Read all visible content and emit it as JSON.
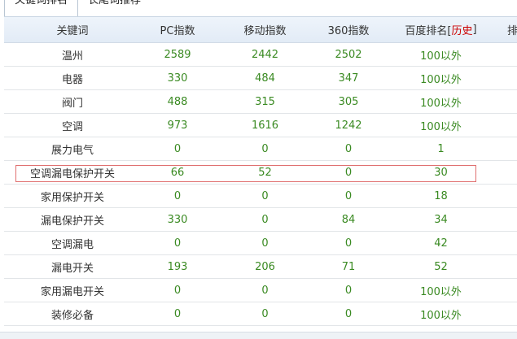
{
  "tabs": [
    {
      "label": "关键词排名"
    },
    {
      "label": "长尾词推荐"
    }
  ],
  "table": {
    "headers": {
      "keyword": "关键词",
      "pc": "PC指数",
      "mobile": "移动指数",
      "so360": "360指数",
      "baidu_prefix": "百度排名[",
      "baidu_history": "历史",
      "baidu_suffix": "]",
      "extra": "排"
    },
    "rows": [
      {
        "keyword": "温州",
        "pc": "2589",
        "mobile": "2442",
        "so360": "2502",
        "baidu": "100以外"
      },
      {
        "keyword": "电器",
        "pc": "330",
        "mobile": "484",
        "so360": "347",
        "baidu": "100以外"
      },
      {
        "keyword": "阀门",
        "pc": "488",
        "mobile": "315",
        "so360": "305",
        "baidu": "100以外"
      },
      {
        "keyword": "空调",
        "pc": "973",
        "mobile": "1616",
        "so360": "1242",
        "baidu": "100以外"
      },
      {
        "keyword": "展力电气",
        "pc": "0",
        "mobile": "0",
        "so360": "0",
        "baidu": "1"
      },
      {
        "keyword": "空调漏电保护开关",
        "pc": "66",
        "mobile": "52",
        "so360": "0",
        "baidu": "30"
      },
      {
        "keyword": "家用保护开关",
        "pc": "0",
        "mobile": "0",
        "so360": "0",
        "baidu": "18"
      },
      {
        "keyword": "漏电保护开关",
        "pc": "330",
        "mobile": "0",
        "so360": "84",
        "baidu": "34"
      },
      {
        "keyword": "空调漏电",
        "pc": "0",
        "mobile": "0",
        "so360": "0",
        "baidu": "42"
      },
      {
        "keyword": "漏电开关",
        "pc": "193",
        "mobile": "206",
        "so360": "71",
        "baidu": "52"
      },
      {
        "keyword": "家用漏电开关",
        "pc": "0",
        "mobile": "0",
        "so360": "0",
        "baidu": "100以外"
      },
      {
        "keyword": "装修必备",
        "pc": "0",
        "mobile": "0",
        "so360": "0",
        "baidu": "100以外"
      }
    ]
  },
  "colors": {
    "value_green": "#3a8a22",
    "history_red": "#cc0000",
    "highlight_border": "#e07070",
    "header_bg": "#e8f0f8"
  }
}
